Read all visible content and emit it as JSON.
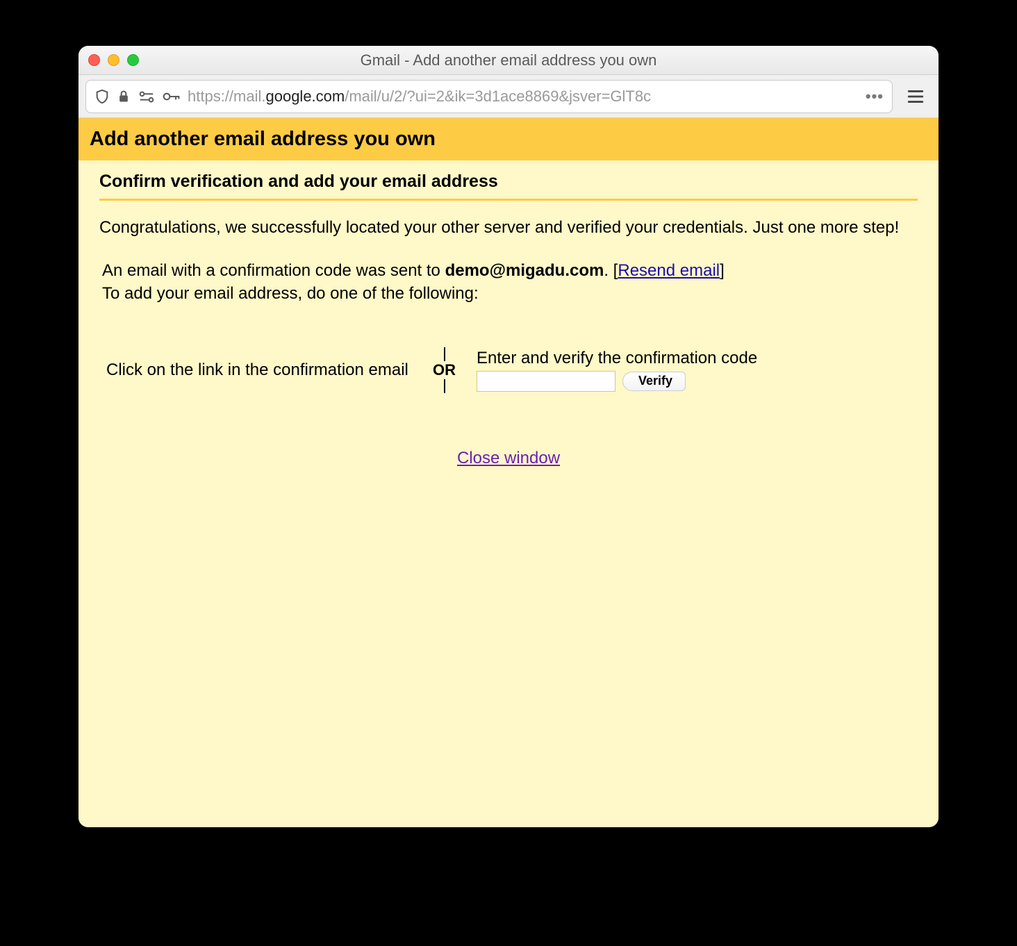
{
  "window": {
    "title": "Gmail - Add another email address you own"
  },
  "url": {
    "scheme_host_prefix": "https://mail.",
    "domain": "google.com",
    "path": "/mail/u/2/?ui=2&ik=3d1ace8869&jsver=GlT8c"
  },
  "page": {
    "header": "Add another email address you own",
    "section_title": "Confirm verification and add your email address",
    "congrats": "Congratulations, we successfully located your other server and verified your credentials. Just one more step!",
    "confirmation_prefix": "An email with a confirmation code was sent to ",
    "email": "demo@migadu.com",
    "confirmation_period": ". [",
    "resend_link": "Resend email",
    "confirmation_close": "]",
    "to_add_line": "To add your email address, do one of the following:",
    "opt_left": "Click on the link in the confirmation email",
    "or_label": "OR",
    "opt_right_label": "Enter and verify the confirmation code",
    "verify_button": "Verify",
    "close_link": "Close window"
  }
}
